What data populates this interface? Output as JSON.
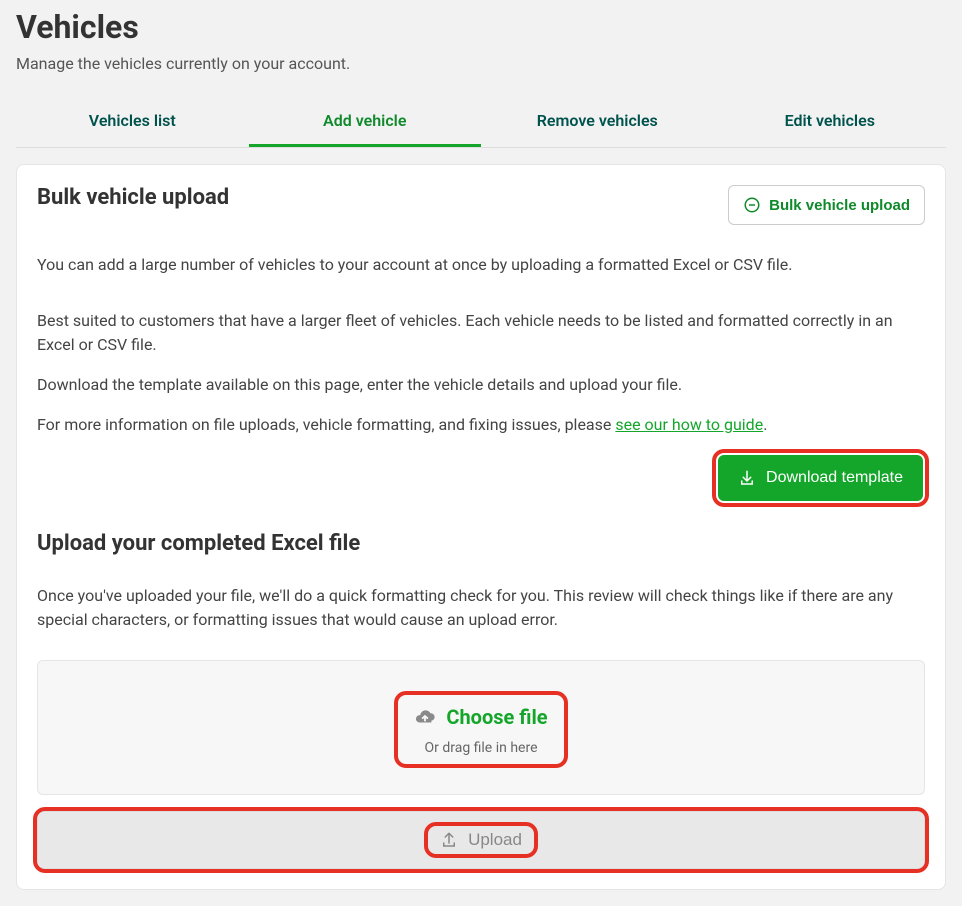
{
  "page": {
    "title": "Vehicles",
    "subtitle": "Manage the vehicles currently on your account."
  },
  "tabs": [
    {
      "label": "Vehicles list",
      "active": false
    },
    {
      "label": "Add vehicle",
      "active": true
    },
    {
      "label": "Remove vehicles",
      "active": false
    },
    {
      "label": "Edit vehicles",
      "active": false
    }
  ],
  "card": {
    "title": "Bulk vehicle upload",
    "collapse_label": "Bulk vehicle upload",
    "p1": "You can add a large number of vehicles to your account at once by uploading a formatted Excel or CSV file.",
    "p2": "Best suited to customers that have a larger fleet of vehicles. Each vehicle needs to be listed and formatted correctly in an Excel or CSV file.",
    "p3": "Download the template available on this page, enter the vehicle details and upload your file.",
    "p4_prefix": "For more information on file uploads, vehicle formatting, and fixing issues, please ",
    "p4_link": "see our how to guide",
    "p4_suffix": ".",
    "download_label": "Download template",
    "upload_section_title": "Upload your completed Excel file",
    "upload_section_text": "Once you've uploaded your file, we'll do a quick formatting check for you. This review will check things like if there are any special characters, or formatting issues that would cause an upload error.",
    "choose_file_label": "Choose file",
    "drop_hint": "Or drag file in here",
    "upload_label": "Upload"
  },
  "colors": {
    "accent": "#14a62a",
    "highlight": "#e63024"
  }
}
